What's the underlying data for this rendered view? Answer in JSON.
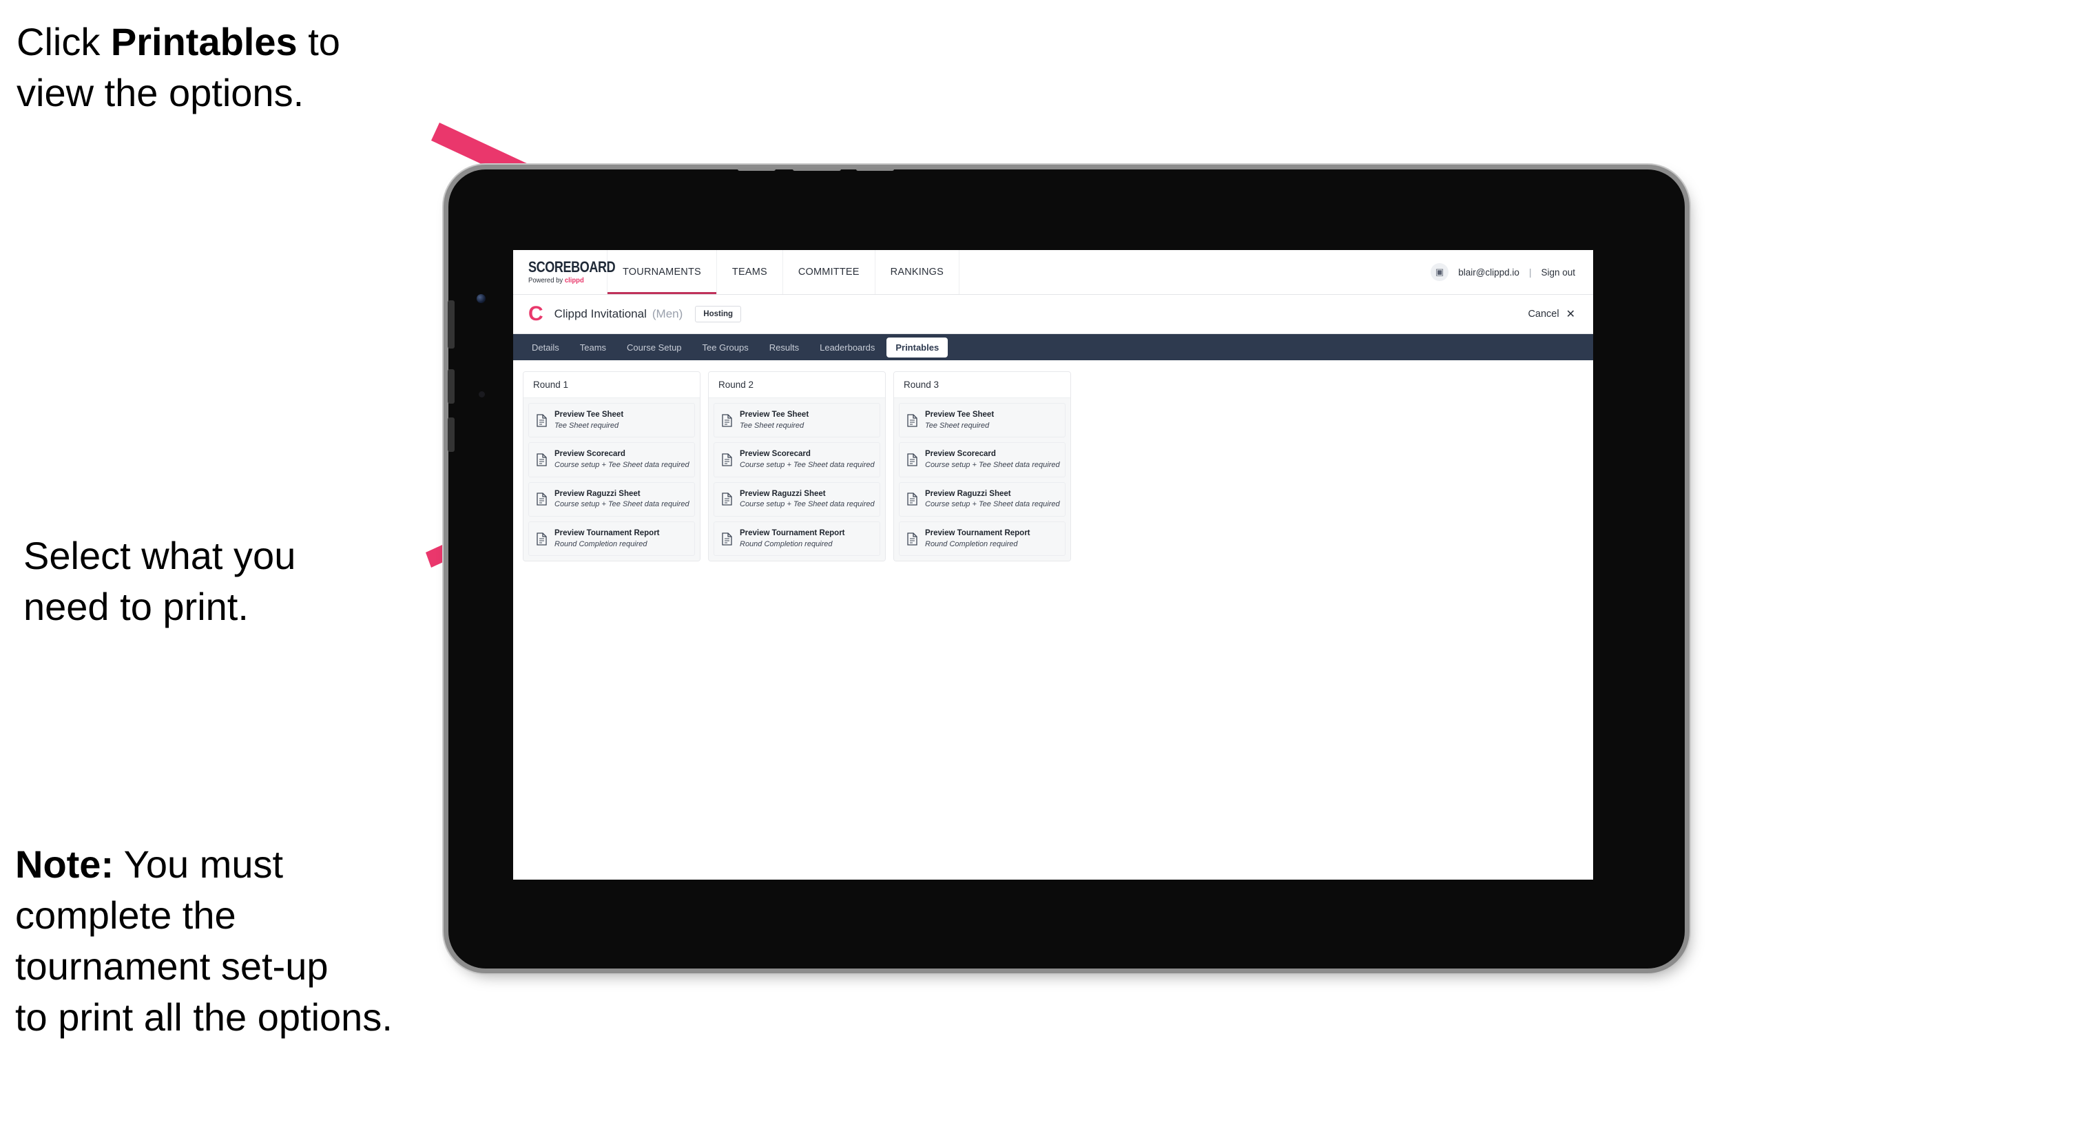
{
  "annotations": {
    "click_printables": {
      "prefix": "Click ",
      "bold": "Printables",
      "suffix": " to\nview the options."
    },
    "select_print": "Select what you\n need to print.",
    "note": {
      "bold": "Note:",
      "rest": " You must\ncomplete the\ntournament set-up\nto print all the options."
    }
  },
  "arrow_color": "#ea376c",
  "app": {
    "global_nav": {
      "brand": {
        "title": "SCOREBOARD",
        "powered_prefix": "Powered by ",
        "powered_brand": "clippd"
      },
      "tabs": [
        {
          "label": "TOURNAMENTS",
          "active": true
        },
        {
          "label": "TEAMS",
          "active": false
        },
        {
          "label": "COMMITTEE",
          "active": false
        },
        {
          "label": "RANKINGS",
          "active": false
        }
      ],
      "account": {
        "avatar_glyph": "▣",
        "email": "blair@clippd.io",
        "separator": "|",
        "sign_out": "Sign out"
      }
    },
    "title_bar": {
      "mark": "C",
      "tournament_name": "Clippd Invitational",
      "gender": "(Men)",
      "badge": "Hosting",
      "cancel_label": "Cancel",
      "cancel_icon": "✕"
    },
    "section_tabs": [
      {
        "label": "Details",
        "active": false
      },
      {
        "label": "Teams",
        "active": false
      },
      {
        "label": "Course Setup",
        "active": false
      },
      {
        "label": "Tee Groups",
        "active": false
      },
      {
        "label": "Results",
        "active": false
      },
      {
        "label": "Leaderboards",
        "active": false
      },
      {
        "label": "Printables",
        "active": true
      }
    ],
    "rounds": [
      {
        "heading": "Round 1",
        "documents": [
          {
            "title": "Preview Tee Sheet",
            "requirement": "Tee Sheet required"
          },
          {
            "title": "Preview Scorecard",
            "requirement": "Course setup + Tee Sheet data required"
          },
          {
            "title": "Preview Raguzzi Sheet",
            "requirement": "Course setup + Tee Sheet data required"
          },
          {
            "title": "Preview Tournament Report",
            "requirement": "Round Completion required"
          }
        ]
      },
      {
        "heading": "Round 2",
        "documents": [
          {
            "title": "Preview Tee Sheet",
            "requirement": "Tee Sheet required"
          },
          {
            "title": "Preview Scorecard",
            "requirement": "Course setup + Tee Sheet data required"
          },
          {
            "title": "Preview Raguzzi Sheet",
            "requirement": "Course setup + Tee Sheet data required"
          },
          {
            "title": "Preview Tournament Report",
            "requirement": "Round Completion required"
          }
        ]
      },
      {
        "heading": "Round 3",
        "documents": [
          {
            "title": "Preview Tee Sheet",
            "requirement": "Tee Sheet required"
          },
          {
            "title": "Preview Scorecard",
            "requirement": "Course setup + Tee Sheet data required"
          },
          {
            "title": "Preview Raguzzi Sheet",
            "requirement": "Course setup + Tee Sheet data required"
          },
          {
            "title": "Preview Tournament Report",
            "requirement": "Round Completion required"
          }
        ]
      }
    ]
  },
  "colors": {
    "accent_pink": "#e8386b",
    "nav_dark": "#2e3a4f",
    "active_underline": "#c0315a"
  }
}
